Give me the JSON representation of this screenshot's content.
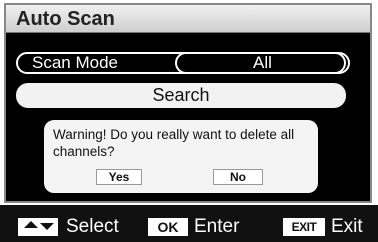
{
  "title": "Auto Scan",
  "scan_mode": {
    "label": "Scan Mode",
    "value": "All"
  },
  "search_label": "Search",
  "dialog": {
    "message": "Warning! Do you really want to delete all channels?",
    "yes_label": "Yes",
    "no_label": "No"
  },
  "footer": {
    "select_label": "Select",
    "ok_key": "OK",
    "enter_label": "Enter",
    "exit_key": "EXIT",
    "exit_label": "Exit"
  }
}
